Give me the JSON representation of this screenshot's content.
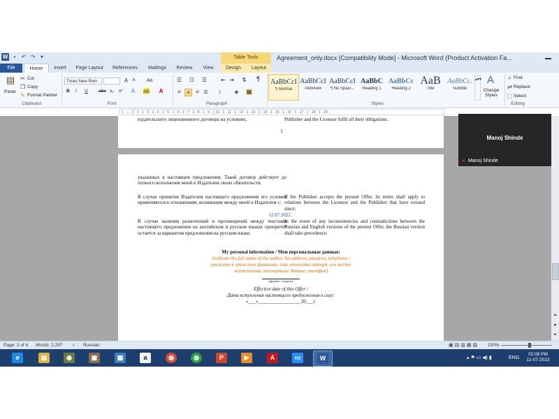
{
  "window": {
    "title": "Agreement_only.docx [Compatibility Mode] - Microsoft Word (Product Activation Fa...",
    "contextual_group": "Table Tools",
    "qat_icons": [
      "word-icon",
      "save-icon",
      "undo-icon",
      "redo-icon",
      "customize-icon"
    ]
  },
  "tabs": [
    "File",
    "Home",
    "Insert",
    "Page Layout",
    "References",
    "Mailings",
    "Review",
    "View",
    "Design",
    "Layout"
  ],
  "ribbon": {
    "clipboard": {
      "paste": "Paste",
      "cut": "Cut",
      "copy": "Copy",
      "format_painter": "Format Painter",
      "label": "Clipboard"
    },
    "font": {
      "font_name": "Times New Rom",
      "font_size": "",
      "label": "Font",
      "buttons": [
        "B",
        "I",
        "U",
        "abe",
        "x₂",
        "x²"
      ]
    },
    "paragraph": {
      "label": "Paragraph",
      "pilcrow": "¶"
    },
    "styles": {
      "label": "Styles",
      "items": [
        {
          "sample": "AaBbCcI",
          "name": "¶ Normal"
        },
        {
          "sample": "AaBbCcI",
          "name": "Рабочий"
        },
        {
          "sample": "AaBbCcI",
          "name": "¶ No Spaci..."
        },
        {
          "sample": "AaBbC",
          "name": "Heading 1"
        },
        {
          "sample": "AaBbCc",
          "name": "Heading 2"
        },
        {
          "sample": "AaB",
          "name": "Title"
        },
        {
          "sample": "AaBbCc.",
          "name": "Subtitle"
        }
      ],
      "change_styles": "Change Styles"
    },
    "editing": {
      "label": "Editing",
      "find": "Find",
      "replace": "Replace",
      "select": "Select"
    }
  },
  "ruler_text": "· 1 · ⌂ · 1 · 2 · 1 · 3 · 1 · 4 · 1 · 5 · 1 · 6 · 1 · 7 · 1 · 8 · 1 · 9 · ▯ 10 · 1 · 11 · 1 · 12 · 1 · 13 · 1 · 14 · 1 · 15 · 1 · 16 · 1 · 17 · 1 · 18 · 1 · 29 ·",
  "document": {
    "page1": {
      "ru_fragment": "издательского лицензионного договора на условиях,",
      "en_fragment": "Publisher and the Licensor fulfil all their obligations.",
      "page_number": "1"
    },
    "page2": {
      "ru_p1": "указанных в настоящем предложении. Такой договор действует до полного исполнения мной и Издателем своих обязательств.",
      "ru_p2": "В случае принятия Издателем настоящего предложения его условия применяются к отношениям, возникшим между мной и Издателем с:",
      "en_p2": "If the Publisher accepts the present Offer, its terms shall apply to relations between the Licensor and the Publisher that have existed since:",
      "date": "12.07.2022.",
      "ru_p3": "В случае наличия разночтений и противоречий между текстами настоящего предложения на английском и русском языках приоритет остается за вариантом предложения на русском языке.",
      "en_p3": "In the event of any inconsistencies and contradictions between the Russian and English versions of the present Offer, the Russian version shall take precedence.",
      "personal_heading": "My personal information / Мои персональные данные:",
      "orange_1": "[indicate the full name of the author, his address, passport, telephone /",
      "orange_2": "укажите в этом поле фамилию, имя, отчество автора, его место",
      "orange_3": "жительства, паспортные данные, телефон]",
      "signature": "signature / подпись",
      "effective_en": "Effective date of this Offer /",
      "effective_ru": "Дата вступления настоящего предложения в силу:",
      "date_line": "«___»_________________ 20___г."
    }
  },
  "video": {
    "name_large": "Manoj Shinde",
    "name_small": "Manoj Shinde"
  },
  "status": {
    "page": "Page: 3 of 4",
    "words": "Words: 2,297",
    "language": "Russian",
    "zoom": "100%"
  },
  "taskbar": {
    "apps": [
      {
        "icon": "internet-explorer-icon",
        "glyph": "e",
        "color": "#1e88e5"
      },
      {
        "icon": "file-explorer-icon",
        "glyph": "▤",
        "color": "#e0b33c"
      },
      {
        "icon": "media-center-icon",
        "glyph": "◉",
        "color": "#6a7b3a"
      },
      {
        "icon": "photo-app-icon",
        "glyph": "▣",
        "color": "#8a6d4b"
      },
      {
        "icon": "desktop-app-icon",
        "glyph": "▦",
        "color": "#3c7dc4"
      },
      {
        "icon": "amazon-icon",
        "glyph": "a",
        "color": "#f2f2f2"
      },
      {
        "icon": "chrome-icon",
        "glyph": "◍",
        "color": "#d84a38"
      },
      {
        "icon": "chrome-alt-icon",
        "glyph": "◍",
        "color": "#2f9e44"
      },
      {
        "icon": "powerpoint-icon",
        "glyph": "P",
        "color": "#d24726"
      },
      {
        "icon": "media-player-icon",
        "glyph": "▶",
        "color": "#f08a24"
      },
      {
        "icon": "acrobat-icon",
        "glyph": "A",
        "color": "#c4161c"
      },
      {
        "icon": "zoom-icon",
        "glyph": "▭",
        "color": "#2d8cff"
      },
      {
        "icon": "word-taskbar-icon",
        "glyph": "W",
        "color": "#2b579a"
      }
    ],
    "lang": "ENG",
    "time": "02:08 PM",
    "date": "12-07-2022"
  }
}
